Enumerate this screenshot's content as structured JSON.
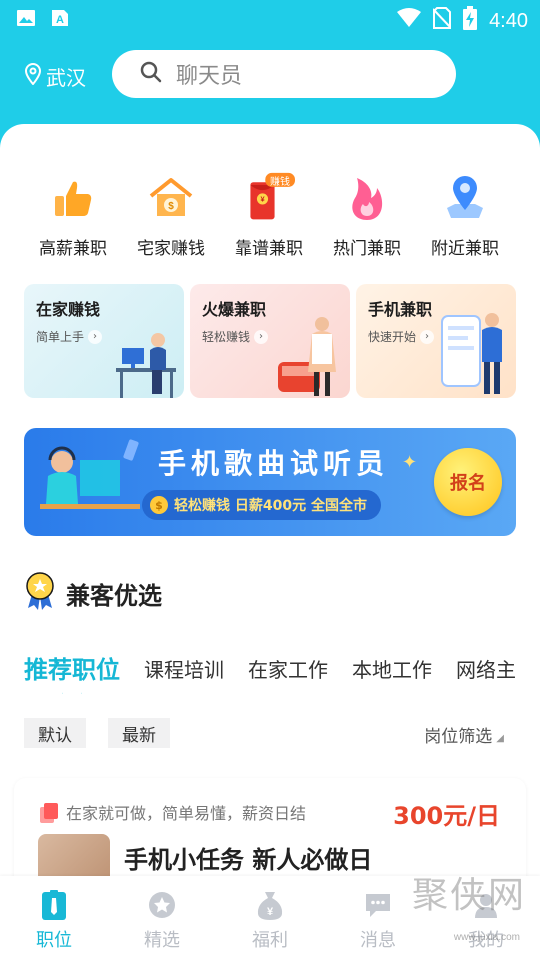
{
  "status_bar": {
    "time": "4:40",
    "icons": [
      "image-icon",
      "a-icon",
      "wifi-icon",
      "no-sim-icon",
      "battery-charging-icon"
    ]
  },
  "header": {
    "location": "武汉",
    "search_placeholder": "聊天员"
  },
  "categories": [
    {
      "label": "高薪兼职",
      "icon": "thumbs-up-icon"
    },
    {
      "label": "宅家赚钱",
      "icon": "home-coin-icon"
    },
    {
      "label": "靠谱兼职",
      "icon": "red-envelope-icon",
      "badge": "赚钱"
    },
    {
      "label": "热门兼职",
      "icon": "flame-icon"
    },
    {
      "label": "附近兼职",
      "icon": "location-pin-icon"
    }
  ],
  "promos": [
    {
      "title": "在家赚钱",
      "subtitle": "简单上手"
    },
    {
      "title": "火爆兼职",
      "subtitle": "轻松赚钱"
    },
    {
      "title": "手机兼职",
      "subtitle": "快速开始"
    }
  ],
  "banner": {
    "title": "手机歌曲试听员",
    "subtitle": "轻松赚钱 日薪400元 全国全市",
    "coin": "$",
    "button": "报名"
  },
  "section": {
    "title": "兼客优选"
  },
  "tabs": [
    {
      "label": "推荐职位",
      "active": true
    },
    {
      "label": "课程培训"
    },
    {
      "label": "在家工作"
    },
    {
      "label": "本地工作"
    },
    {
      "label": "网络主"
    }
  ],
  "filters": {
    "chips": [
      "默认",
      "最新"
    ],
    "select": "岗位筛选"
  },
  "job": {
    "tagline": "在家就可做，简单易懂，薪资日结",
    "salary": "300元/日",
    "title": "手机小任务 新人必做日"
  },
  "bottom_nav": [
    {
      "label": "职位",
      "icon": "job-icon",
      "active": true
    },
    {
      "label": "精选",
      "icon": "star-badge-icon"
    },
    {
      "label": "福利",
      "icon": "money-bag-icon"
    },
    {
      "label": "消息",
      "icon": "message-icon"
    },
    {
      "label": "我的",
      "icon": "profile-icon"
    }
  ],
  "watermark": {
    "text": "聚侠网",
    "url": "www.juxia.com"
  },
  "colors": {
    "primary": "#1fcde8",
    "accent": "#18b8d6",
    "salary": "#e8452c"
  }
}
